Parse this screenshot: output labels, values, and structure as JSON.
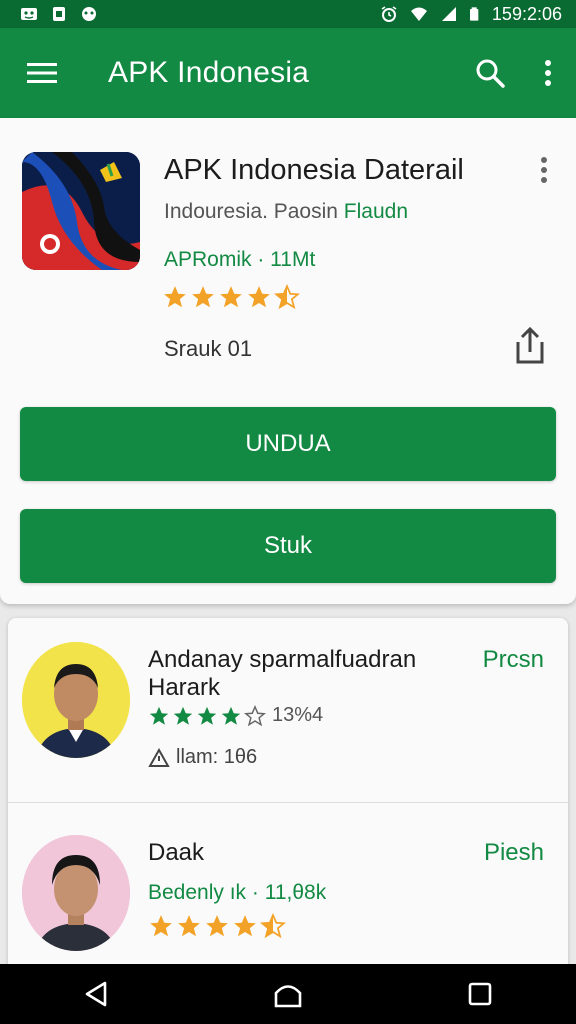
{
  "status_bar": {
    "time": "159:2:06"
  },
  "app_bar": {
    "title": "APK Indonesia"
  },
  "detail": {
    "title": "APK Indonesia Daterail",
    "subtitle_a": "Indouresia. Paosin",
    "subtitle_b": "Flaudn",
    "meta": "APRomik · 11Mt",
    "rating": 4.5,
    "count": "Srauk 01",
    "download_label": "UNDUA",
    "secondary_label": "Stuk"
  },
  "list": [
    {
      "title": "Andanay sparmalfuadran Harark",
      "action": "Prcsn",
      "rating_count": "13%4",
      "meta": "llam: 1θ6"
    },
    {
      "title": "Daak",
      "action": "Piesh",
      "subtitle": "Bedenly ık · 11,θ8k",
      "rating": 4.5
    }
  ],
  "colors": {
    "primary": "#138a43",
    "status_bar": "#0a6b32",
    "star": "#f2a227"
  }
}
